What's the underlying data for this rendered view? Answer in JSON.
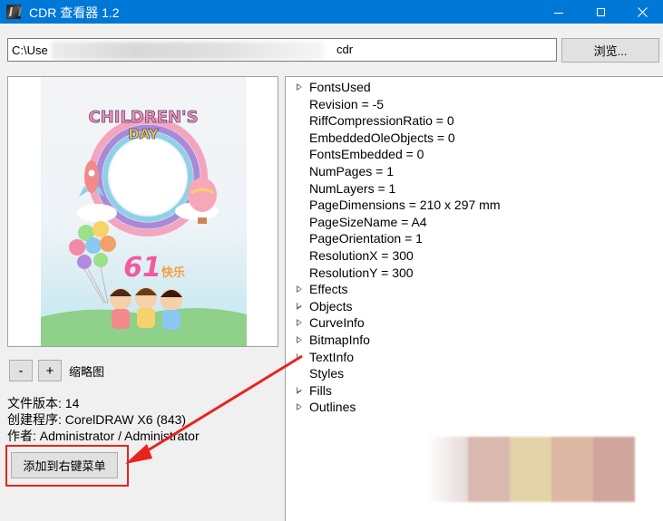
{
  "window": {
    "title": "CDR 查看器 1.2"
  },
  "toolbar": {
    "path_prefix": "C:\\Use",
    "path_suffix": "cdr",
    "browse_label": "浏览..."
  },
  "preview": {
    "zoom_out_label": "-",
    "zoom_in_label": "+",
    "thumbnail_label": "缩略图"
  },
  "info": {
    "version": "文件版本: 14",
    "creator": "创建程序: CorelDRAW X6 (843)",
    "author": "作者: Administrator / Administrator"
  },
  "actions": {
    "add_context_menu_label": "添加到右键菜单"
  },
  "tree": {
    "items": [
      {
        "label": "FontsUsed",
        "expandable": true
      },
      {
        "label": "Revision = -5",
        "expandable": false
      },
      {
        "label": "RiffCompressionRatio = 0",
        "expandable": false
      },
      {
        "label": "EmbeddedOleObjects = 0",
        "expandable": false
      },
      {
        "label": "FontsEmbedded = 0",
        "expandable": false
      },
      {
        "label": "NumPages = 1",
        "expandable": false
      },
      {
        "label": "NumLayers = 1",
        "expandable": false
      },
      {
        "label": "PageDimensions = 210 x 297 mm",
        "expandable": false
      },
      {
        "label": "PageSizeName = A4",
        "expandable": false
      },
      {
        "label": "PageOrientation = 1",
        "expandable": false
      },
      {
        "label": "ResolutionX = 300",
        "expandable": false
      },
      {
        "label": "ResolutionY = 300",
        "expandable": false
      },
      {
        "label": "Effects",
        "expandable": true
      },
      {
        "label": "Objects",
        "expandable": true
      },
      {
        "label": "CurveInfo",
        "expandable": true
      },
      {
        "label": "BitmapInfo",
        "expandable": true
      },
      {
        "label": "TextInfo",
        "expandable": true
      },
      {
        "label": "Styles",
        "expandable": false
      },
      {
        "label": "Fills",
        "expandable": true
      },
      {
        "label": "Outlines",
        "expandable": true
      }
    ]
  },
  "thumbnail_art": {
    "headline": "CHILDREN'S",
    "subline": "DAY",
    "number": "61",
    "caption": "快乐"
  },
  "colors": {
    "titlebar": "#0078d7",
    "highlight": "#e8231e"
  }
}
